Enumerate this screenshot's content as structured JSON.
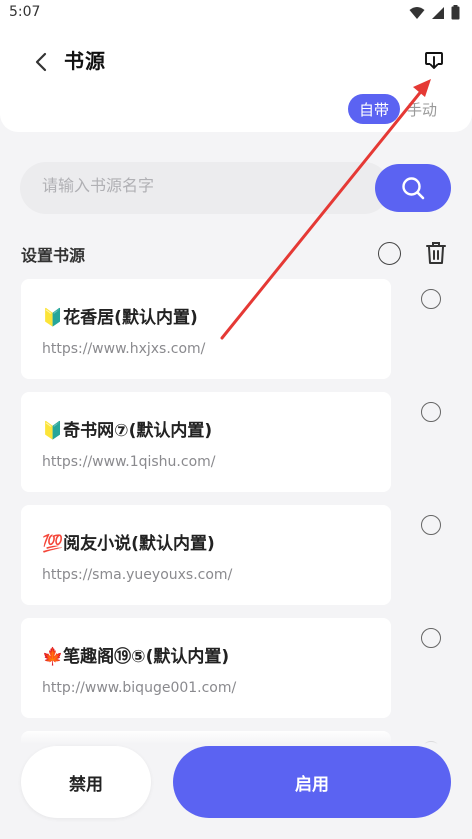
{
  "status_bar": {
    "time": "5:07",
    "icons": [
      "wifi-icon",
      "signal-icon",
      "battery-icon"
    ]
  },
  "header": {
    "title": "书源",
    "back_icon": "chevron-left-icon",
    "import_icon": "download-tray-icon",
    "mode_auto_label": "自带",
    "mode_manual_label": "手动"
  },
  "search": {
    "placeholder": "请输入书源名字",
    "value": "",
    "button_icon": "search-icon"
  },
  "section": {
    "title": "设置书源",
    "delete_icon": "trash-icon"
  },
  "sources": [
    {
      "badge": "🔰",
      "name": "花香居(默认内置)",
      "url": "https://www.hxjxs.com/"
    },
    {
      "badge": "🔰",
      "name": "奇书网⑦(默认内置)",
      "url": "https://www.1qishu.com/"
    },
    {
      "badge": "💯",
      "name": "阅友小说(默认内置)",
      "url": "https://sma.yueyouxs.com/"
    },
    {
      "badge": "🍁",
      "name": "笔趣阁⑲⑤(默认内置)",
      "url": "http://www.biquge001.com/"
    },
    {
      "badge": "",
      "name": "",
      "url": ""
    }
  ],
  "actions": {
    "disable_label": "禁用",
    "enable_label": "启用"
  },
  "colors": {
    "accent": "#5b63f2",
    "annotation_arrow": "#e53935",
    "background": "#f4f4f6"
  }
}
